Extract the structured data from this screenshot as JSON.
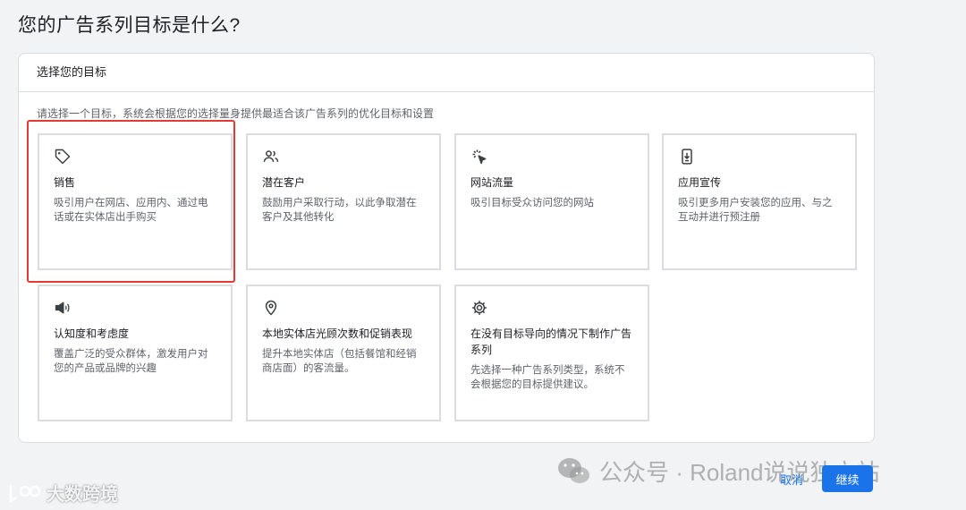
{
  "page": {
    "title": "您的广告系列目标是什么?"
  },
  "panel": {
    "header": "选择您的目标",
    "instruction": "请选择一个目标，系统会根据您的选择量身提供最适合该广告系列的优化目标和设置"
  },
  "cards": [
    {
      "icon": "tag-icon",
      "title": "销售",
      "desc": "吸引用户在网店、应用内、通过电话或在实体店出手购买",
      "selected": true
    },
    {
      "icon": "people-icon",
      "title": "潜在客户",
      "desc": "鼓励用户采取行动，以此争取潜在客户及其他转化"
    },
    {
      "icon": "cursor-click-icon",
      "title": "网站流量",
      "desc": "吸引目标受众访问您的网站"
    },
    {
      "icon": "phone-download-icon",
      "title": "应用宣传",
      "desc": "吸引更多用户安装您的应用、与之互动并进行预注册"
    },
    {
      "icon": "megaphone-icon",
      "title": "认知度和考虑度",
      "desc": "覆盖广泛的受众群体，激发用户对您的产品或品牌的兴趣"
    },
    {
      "icon": "location-pin-icon",
      "title": "本地实体店光顾次数和促销表现",
      "desc": "提升本地实体店（包括餐馆和经销商店面）的客流量。"
    },
    {
      "icon": "gear-icon",
      "title": "在没有目标导向的情况下制作广告系列",
      "desc": "先选择一种广告系列类型，系统不会根据您的目标提供建议。"
    }
  ],
  "footer": {
    "cancel": "取消",
    "continue": "继续"
  },
  "watermark": {
    "text": "公众号 · Roland说说独立站"
  },
  "logo": {
    "text": "大数跨境"
  },
  "colors": {
    "accent": "#1a73e8",
    "highlight": "#e53935",
    "border": "#dadce0"
  }
}
